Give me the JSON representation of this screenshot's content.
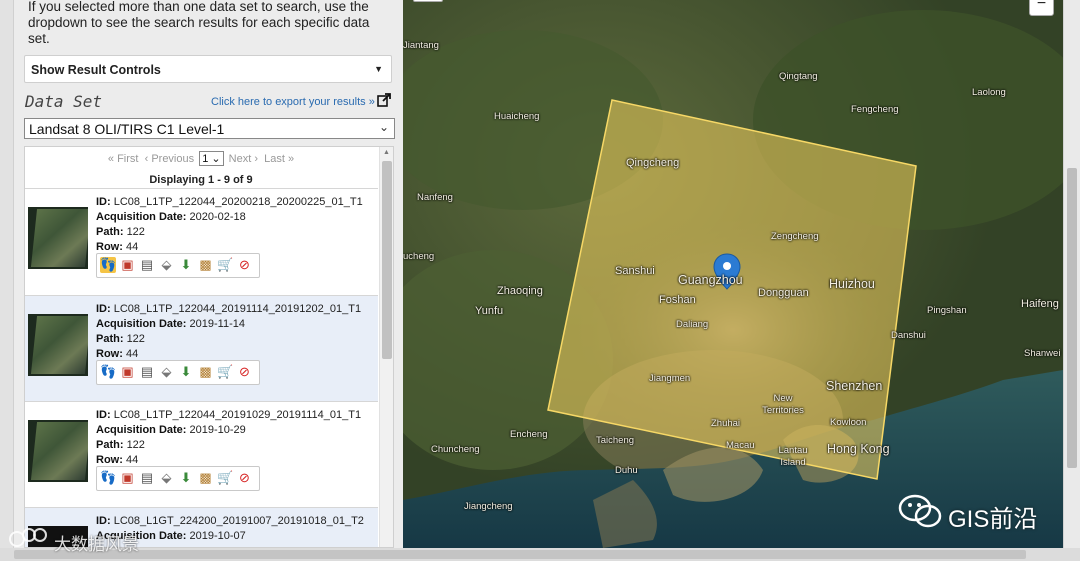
{
  "left_panel": {
    "info_text": "If you selected more than one data set to search, use the dropdown to see the search results for each specific data set.",
    "result_controls_label": "Show Result Controls",
    "dataset_heading": "Data Set",
    "export_link": "Click here to export your results »",
    "dataset_selected": "Landsat 8 OLI/TIRS C1 Level-1",
    "pager": {
      "first": "« First",
      "previous": "‹ Previous",
      "page": "1",
      "next": "Next ›",
      "last": "Last »"
    },
    "displaying": "Displaying 1 - 9 of 9",
    "field_labels": {
      "id": "ID:",
      "date": "Acquisition Date:",
      "path": "Path:",
      "row": "Row:"
    },
    "results": [
      {
        "id": "LC08_L1TP_122044_20200218_20200225_01_T1",
        "date": "2020-02-18",
        "path": "122",
        "row": "44"
      },
      {
        "id": "LC08_L1TP_122044_20191114_20191202_01_T1",
        "date": "2019-11-14",
        "path": "122",
        "row": "44"
      },
      {
        "id": "LC08_L1TP_122044_20191029_20191114_01_T1",
        "date": "2019-10-29",
        "path": "122",
        "row": "44"
      },
      {
        "id": "LC08_L1GT_224200_20191007_20191018_01_T2",
        "date": "2019-10-07",
        "path": "",
        "row": ""
      }
    ],
    "result_action_icons": [
      "footprint-icon",
      "browse-overlay-icon",
      "metadata-icon",
      "compare-icon",
      "download-icon",
      "bulk-download-icon",
      "cart-icon",
      "exclude-icon"
    ]
  },
  "map": {
    "zoom_label": "−",
    "labels": {
      "jiantang": "Jiantang",
      "qingtang": "Qingtang",
      "laolong": "Laolong",
      "huaicheng": "Huaicheng",
      "fengcheng": "Fengcheng",
      "qingcheng": "Qingcheng",
      "nanfeng": "Nanfeng",
      "zengcheng": "Zengcheng",
      "sanshui": "Sanshui",
      "guangzhou": "Guangzhou",
      "huizhou": "Huizhou",
      "zhaoqing": "Zhaoqing",
      "foshan": "Foshan",
      "dongguan": "Dongguan",
      "pingshan": "Pingshan",
      "haifeng": "Haifeng",
      "yunfu": "Yunfu",
      "daliang": "Daliang",
      "danshui": "Danshui",
      "shanwei": "Shanwei",
      "lucheng": "ucheng",
      "jiangmen": "Jiangmen",
      "shenzhen": "Shenzhen",
      "new_territories": "New Territories",
      "kowloon": "Kowloon",
      "hong_kong": "Hong Kong",
      "encheng": "Encheng",
      "taicheng": "Taicheng",
      "zhuhai": "Zhuhai",
      "macau": "Macau",
      "lantau": "Lantau Island",
      "chuncheng": "Chuncheng",
      "duhu": "Duhu",
      "jiangcheng": "Jiangcheng"
    },
    "footprint_color": "#f2cf5e",
    "marker_color": "#2b7bd3"
  },
  "watermarks": {
    "wechat": "GIS前沿",
    "bigdata": "大数据风景"
  }
}
